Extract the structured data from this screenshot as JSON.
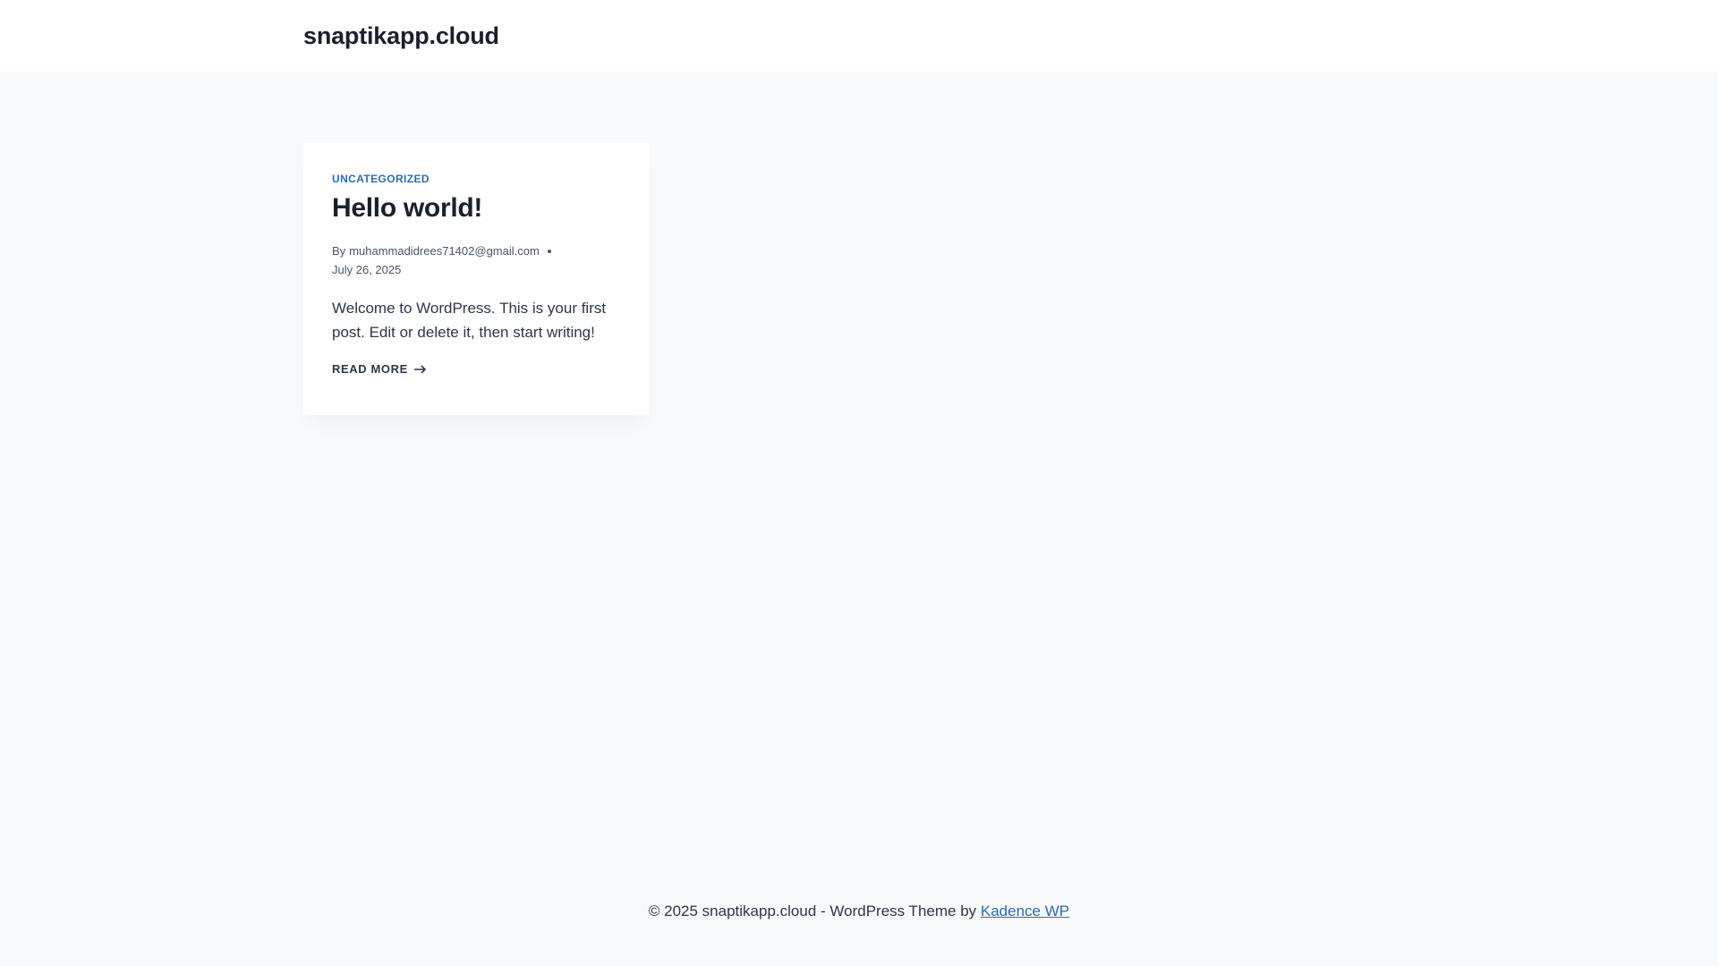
{
  "header": {
    "site_title": "snaptikapp.cloud"
  },
  "post": {
    "category": "UNCATEGORIZED",
    "title": "Hello world!",
    "by_label": "By",
    "author": "muhammadidrees71402@gmail.com",
    "date": "July 26, 2025",
    "excerpt": "Welcome to WordPress. This is your first post. Edit or delete it, then start writing!",
    "read_more": "READ MORE",
    "read_more_icon": "arrow-right-icon"
  },
  "footer": {
    "copyright_text": "© 2025 snaptikapp.cloud - WordPress Theme by ",
    "theme_link": "Kadence WP"
  },
  "colors": {
    "page_background": "#f7f9fb",
    "link_accent": "#2b6cb0",
    "heading": "#1a202c"
  }
}
